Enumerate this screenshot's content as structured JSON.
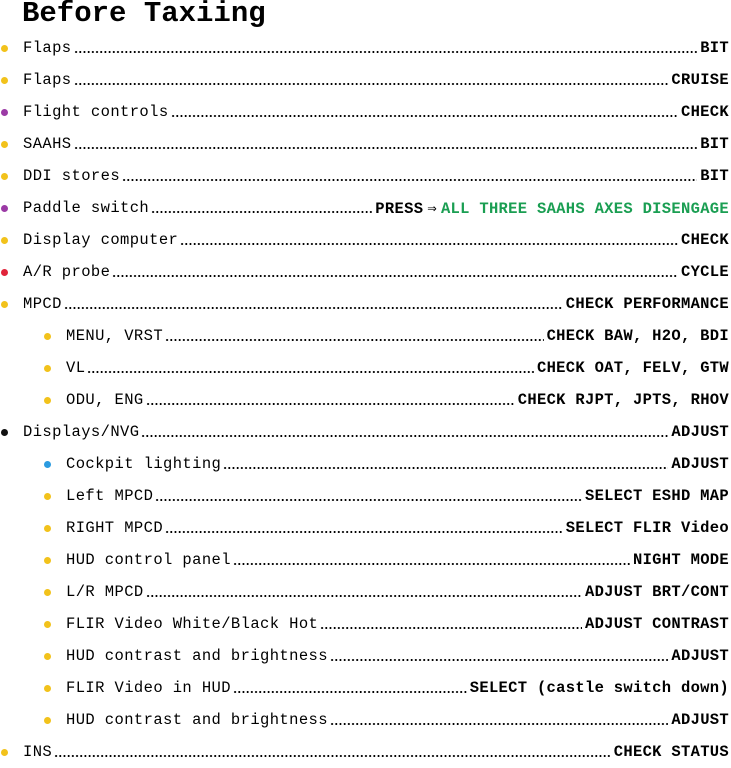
{
  "title": "Before Taxiing",
  "colors": {
    "yellow": "#f2c21b",
    "purple": "#9b3aa5",
    "red": "#e0243a",
    "black": "#111111",
    "blue": "#2b9be0",
    "green": "#1a9e52"
  },
  "items": [
    {
      "label": "Flaps",
      "value": "BIT",
      "bullet": "yellow",
      "level": 0
    },
    {
      "label": "Flaps",
      "value": "CRUISE",
      "bullet": "yellow",
      "level": 0
    },
    {
      "label": "Flight controls",
      "value": "CHECK",
      "bullet": "purple",
      "level": 0
    },
    {
      "label": "SAAHS",
      "value": "BIT",
      "bullet": "yellow",
      "level": 0
    },
    {
      "label": "DDI stores",
      "value": "BIT",
      "bullet": "yellow",
      "level": 0
    },
    {
      "label": "Paddle switch",
      "value": "PRESS",
      "arrow": "⇒",
      "extra": "ALL THREE SAAHS AXES DISENGAGE",
      "bullet": "purple",
      "level": 0
    },
    {
      "label": "Display computer",
      "value": "CHECK",
      "bullet": "yellow",
      "level": 0
    },
    {
      "label": "A/R probe",
      "value": "CYCLE",
      "bullet": "red",
      "level": 0
    },
    {
      "label": "MPCD",
      "value": "CHECK PERFORMANCE",
      "bullet": "yellow",
      "level": 0
    },
    {
      "label": "MENU, VRST",
      "value": "CHECK BAW, H2O, BDI",
      "bullet": "yellow",
      "level": 1
    },
    {
      "label": "VL",
      "value": "CHECK OAT, FELV, GTW",
      "bullet": "yellow",
      "level": 1
    },
    {
      "label": "ODU, ENG",
      "value": "CHECK RJPT, JPTS, RHOV",
      "bullet": "yellow",
      "level": 1
    },
    {
      "label": "Displays/NVG",
      "value": "ADJUST",
      "bullet": "black",
      "level": 0
    },
    {
      "label": "Cockpit lighting",
      "value": "ADJUST",
      "bullet": "blue",
      "level": 1
    },
    {
      "label": "Left MPCD",
      "value": "SELECT ESHD MAP",
      "bullet": "yellow",
      "level": 1
    },
    {
      "label": "RIGHT MPCD",
      "value": "SELECT FLIR Video",
      "bullet": "yellow",
      "level": 1
    },
    {
      "label": "HUD control panel",
      "value": "NIGHT MODE",
      "bullet": "yellow",
      "level": 1
    },
    {
      "label": "L/R MPCD",
      "value": "ADJUST BRT/CONT",
      "bullet": "yellow",
      "level": 1
    },
    {
      "label": "FLIR Video White/Black Hot",
      "value": "ADJUST CONTRAST",
      "bullet": "yellow",
      "level": 1
    },
    {
      "label": "HUD contrast and brightness",
      "value": "ADJUST",
      "bullet": "yellow",
      "level": 1
    },
    {
      "label": "FLIR Video in HUD",
      "value": "SELECT (castle switch down)",
      "bullet": "yellow",
      "level": 1
    },
    {
      "label": "HUD contrast and brightness",
      "value": "ADJUST",
      "bullet": "yellow",
      "level": 1
    },
    {
      "label": "INS",
      "value": "CHECK STATUS",
      "bullet": "yellow",
      "level": 0
    }
  ]
}
